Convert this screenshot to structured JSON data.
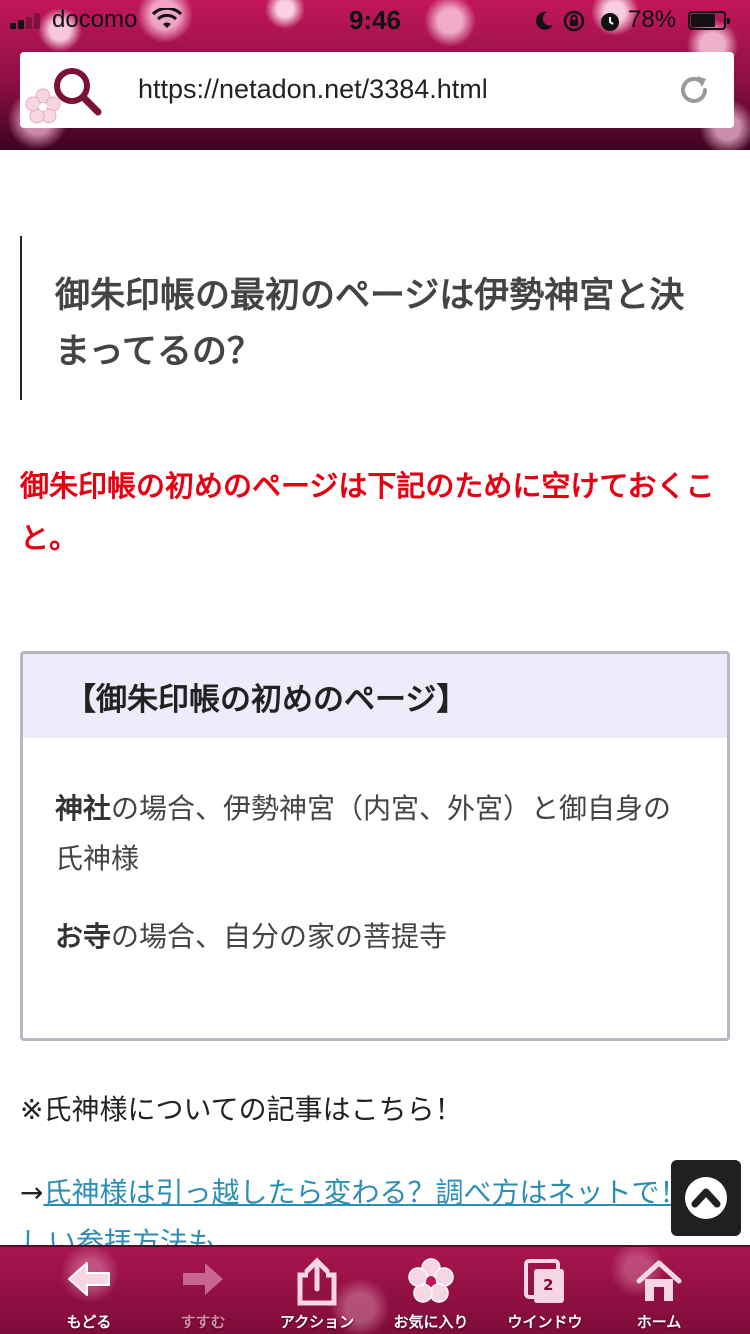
{
  "status_bar": {
    "carrier": "docomo",
    "time": "9:46",
    "battery_pct": "78%"
  },
  "browser": {
    "url": "https://netadon.net/3384.html"
  },
  "article": {
    "heading": "御朱印帳の最初のページは伊勢神宮と決まってるの？",
    "notice": "御朱印帳の初めのページは下記のために空けておくこと。",
    "box": {
      "title": "【御朱印帳の初めのページ】",
      "items": [
        {
          "bold": "神社",
          "rest": "の場合、伊勢神宮（内宮、外宮）と御自身の氏神様"
        },
        {
          "bold": "お寺",
          "rest": "の場合、自分の家の菩提寺"
        }
      ]
    },
    "ref_note": "※氏神様についての記事はこちら！",
    "link_arrow": "→",
    "link_text": "氏神様は引っ越したら変わる？調べ方はネットで！正しい参拝方法も"
  },
  "toolbar": {
    "back": "もどる",
    "forward": "すすむ",
    "action": "アクション",
    "favorites": "お気に入り",
    "window": "ウインドウ",
    "window_count": "2",
    "home": "ホーム"
  },
  "colors": {
    "accent_pink": "#a8154f",
    "notice_red": "#e60012",
    "link_blue": "#2a8eb6",
    "box_title_bg": "#ececfb"
  }
}
